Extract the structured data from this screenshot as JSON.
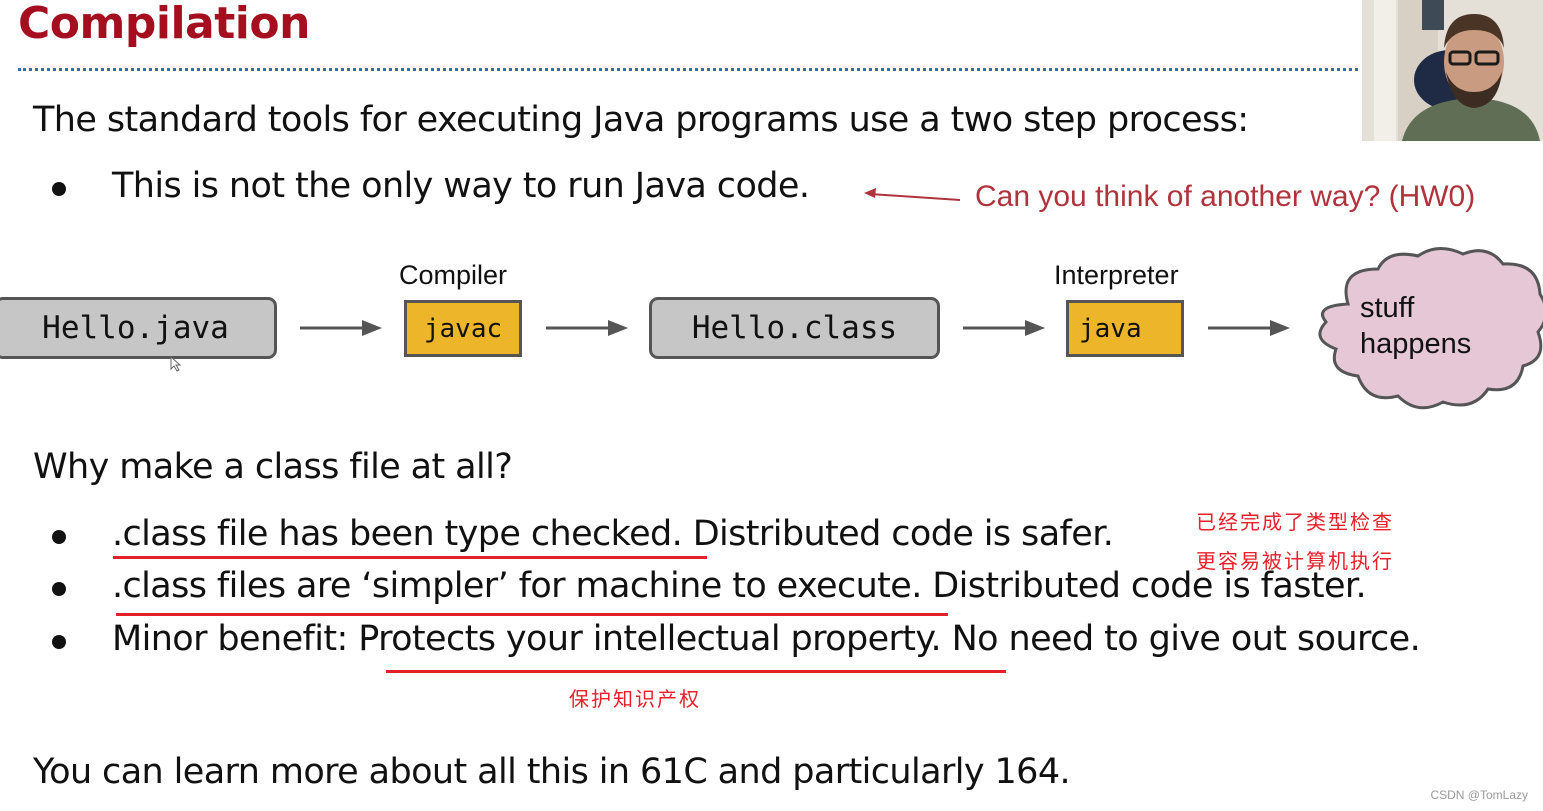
{
  "slide": {
    "title": "Compilation",
    "intro": "The standard tools for executing Java programs use a two step process:",
    "bullet_1": "This is not the only way to run Java code.",
    "annotation": "Can you think of another way? (HW0)",
    "diagram": {
      "source_file": "Hello.java",
      "compiler_label": "Compiler",
      "compiler_cmd": "javac",
      "class_file": "Hello.class",
      "interpreter_label": "Interpreter",
      "interpreter_cmd": "java",
      "result_line1": "stuff",
      "result_line2": "happens"
    },
    "question": "Why make a class file at all?",
    "reasons": [
      {
        "underlined": ".class file has been type checked.",
        "rest": " Distributed code is safer."
      },
      {
        "underlined": ".class files are ‘simpler’ for machine to execute.",
        "rest": " Distributed code is faster."
      },
      {
        "prefix": "Minor benefit: ",
        "underlined": "Protects your intellectual property.",
        "rest": " No need to give out source."
      }
    ],
    "footer": "You can learn more about all this in 61C and particularly 164."
  },
  "notes": {
    "note_1": "已经完成了类型检查",
    "note_2": "更容易被计算机执行",
    "note_3": "保护知识产权"
  },
  "watermark": "CSDN @TomLazy",
  "colors": {
    "title": "#a50e1e",
    "annotation": "#b0333c",
    "underline": "#e3202a",
    "compiler_box": "#edb52a",
    "file_box": "#c6c6c6",
    "cloud": "#e5c7d6",
    "divider": "#2e6db4"
  }
}
